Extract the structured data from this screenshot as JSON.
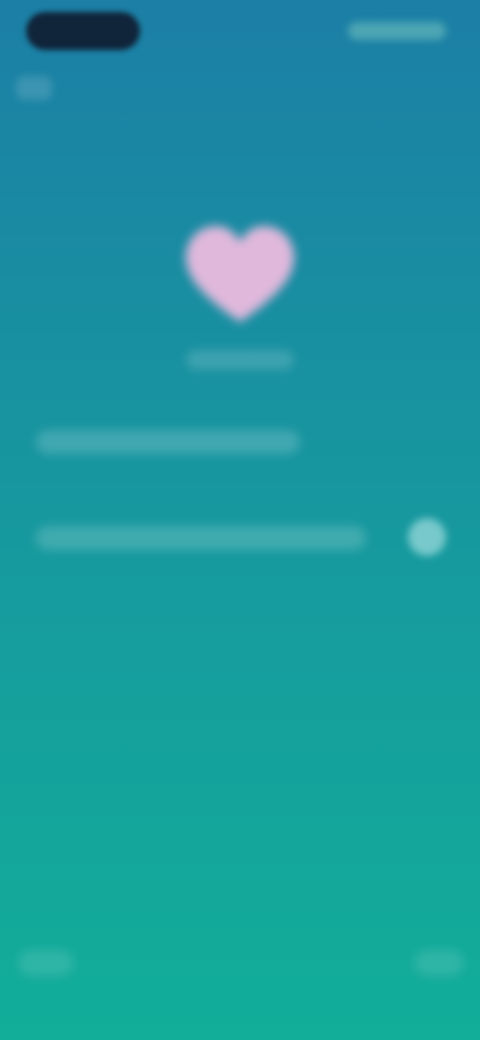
{
  "status_bar": {
    "time": "",
    "right_indicators": ""
  },
  "heart": {
    "color": "#e0b8dc",
    "label": ""
  },
  "rows": [
    {
      "text": ""
    },
    {
      "text": ""
    }
  ],
  "colors": {
    "gradient_top": "#1c7fa6",
    "gradient_bottom": "#12ae99"
  }
}
